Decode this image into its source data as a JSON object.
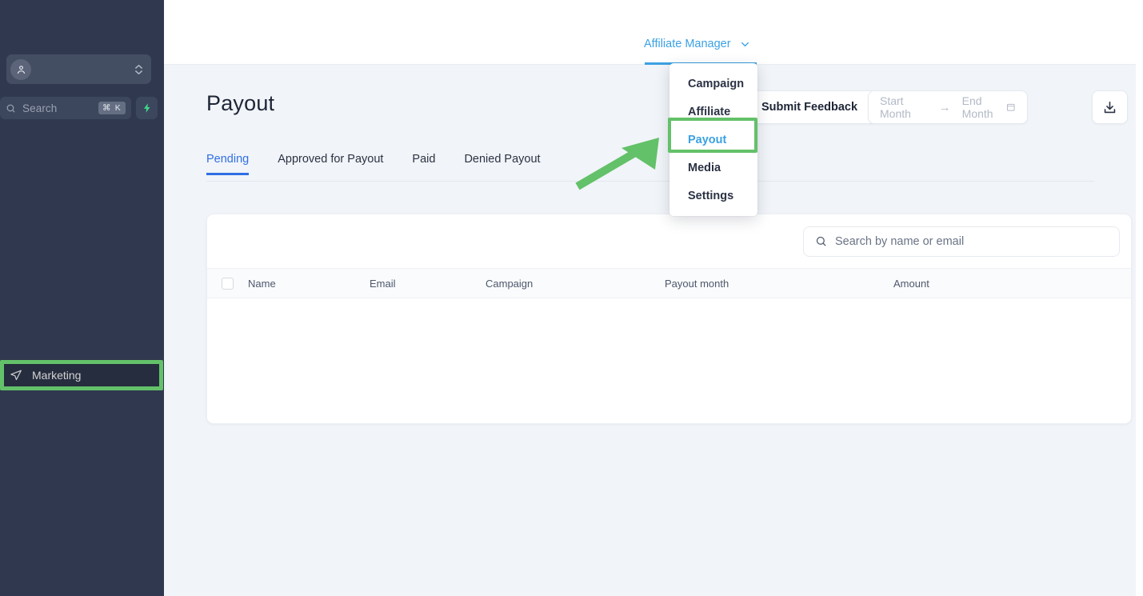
{
  "sidebar": {
    "org_selector": {
      "icon": "user-pin-icon",
      "value": "",
      "chevron": "chevron-up-down-icon"
    },
    "search": {
      "icon": "search-icon",
      "placeholder": "Search",
      "shortcut": "⌘ K",
      "ai_icon": "lightning-bolt-icon"
    },
    "nav": {
      "marketing": {
        "label": "Marketing",
        "icon": "send-icon"
      }
    },
    "colors": {
      "background": "#2f384e",
      "field": "#3c465c",
      "accent_green": "#3dd68c"
    }
  },
  "header": {
    "nav_title": "Affiliate Manager",
    "chevron": "chevron-down-icon",
    "accent": "#3ba1e3"
  },
  "menu": {
    "items": [
      {
        "label": "Campaign",
        "selected": false
      },
      {
        "label": "Affiliate",
        "selected": false
      },
      {
        "label": "Payout",
        "selected": true
      },
      {
        "label": "Media",
        "selected": false
      },
      {
        "label": "Settings",
        "selected": false
      }
    ]
  },
  "page": {
    "title": "Payout",
    "feedback_button": "Submit Feedback",
    "date_range": {
      "start_placeholder": "Start Month",
      "separator": "→",
      "end_placeholder": "End Month",
      "icon": "calendar-icon"
    },
    "download_button_icon": "download-icon"
  },
  "tabs": [
    {
      "label": "Pending",
      "active": true
    },
    {
      "label": "Approved for Payout",
      "active": false
    },
    {
      "label": "Paid",
      "active": false
    },
    {
      "label": "Denied Payout",
      "active": false
    }
  ],
  "table": {
    "search": {
      "icon": "search-icon",
      "placeholder": "Search by name or email",
      "value": ""
    },
    "columns": [
      "Name",
      "Email",
      "Campaign",
      "Payout month",
      "Amount"
    ],
    "rows": []
  },
  "annotations": {
    "highlight_color": "#63c169",
    "marketing_box": "highlight-marketing",
    "payout_box": "highlight-payout",
    "arrow": "arrow-pointing-to-payout"
  }
}
